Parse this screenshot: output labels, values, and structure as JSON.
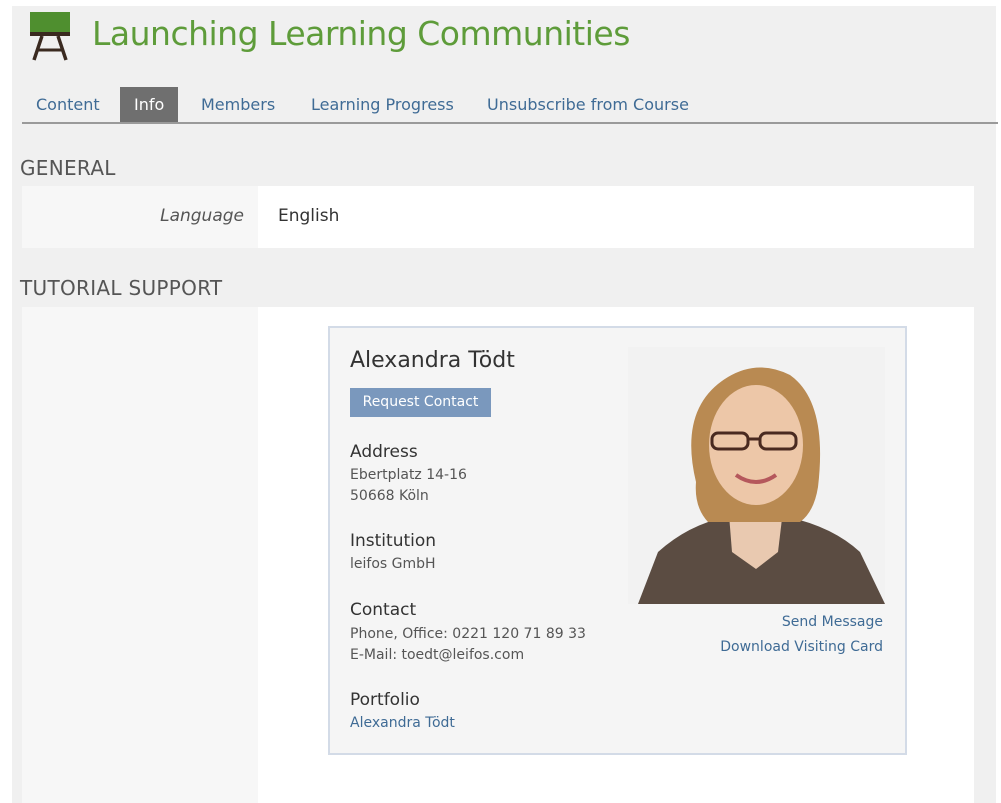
{
  "header": {
    "title": "Launching Learning Communities",
    "course_icon": "easel-icon"
  },
  "tabs": [
    {
      "label": "Content",
      "active": false
    },
    {
      "label": "Info",
      "active": true
    },
    {
      "label": "Members",
      "active": false
    },
    {
      "label": "Learning Progress",
      "active": false
    },
    {
      "label": "Unsubscribe from Course",
      "active": false
    }
  ],
  "general": {
    "title": "GENERAL",
    "language_label": "Language",
    "language_value": "English"
  },
  "tutorial_support": {
    "title": "TUTORIAL SUPPORT",
    "tutor": {
      "name": "Alexandra Tödt",
      "request_contact_label": "Request Contact",
      "address_title": "Address",
      "address_lines": [
        "Ebertplatz 14-16",
        "50668 Köln"
      ],
      "institution_title": "Institution",
      "institution_value": "leifos GmbH",
      "contact_title": "Contact",
      "contact_lines": [
        "Phone, Office: 0221 120 71 89 33",
        "E-Mail: toedt@leifos.com"
      ],
      "portfolio_title": "Portfolio",
      "portfolio_link": "Alexandra Tödt",
      "send_message_label": "Send Message",
      "download_card_label": "Download Visiting Card"
    }
  },
  "colors": {
    "title_green": "#5e9c3a",
    "link_blue": "#3f6b95",
    "active_tab_bg": "#6f6f6f",
    "button_bg": "#7a98bd",
    "card_border": "#d3dbe7"
  }
}
